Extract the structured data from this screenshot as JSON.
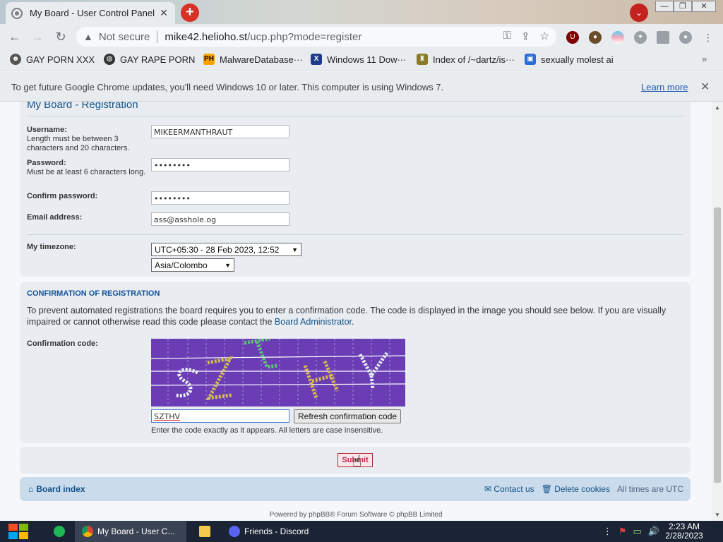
{
  "browser": {
    "tab_title": "My Board - User Control Panel",
    "not_secure": "Not secure",
    "url_host": "mike42.helioho.st",
    "url_path": "/ucp.php?mode=register",
    "infobar_message": "To get future Google Chrome updates, you'll need Windows 10 or later. This computer is using Windows 7.",
    "infobar_link": "Learn more",
    "bookmarks": [
      {
        "label": "GAY PORN XXX"
      },
      {
        "label": "GAY RAPE PORN"
      },
      {
        "label": "MalwareDatabase···"
      },
      {
        "label": "Windows 11 Dow···"
      },
      {
        "label": "Index of /~dartz/is···"
      },
      {
        "label": "sexually molest ai"
      }
    ],
    "bookmark_more": "»"
  },
  "form": {
    "page_title": "My Board - Registration",
    "username_label": "Username:",
    "username_explain": "Length must be between 3 characters and 20 characters.",
    "username_value": "MIKEERMANTHRAUT",
    "password_label": "Password:",
    "password_explain": "Must be at least 6 characters long.",
    "password_value": "••••••••",
    "confirm_label": "Confirm password:",
    "confirm_value": "••••••••",
    "email_label": "Email address:",
    "email_value": "ass@asshole.og",
    "timezone_label": "My timezone:",
    "timezone_value": "UTC+05:30 - 28 Feb 2023, 12:52",
    "timezone_city": "Asia/Colombo"
  },
  "confirmation": {
    "heading": "Confirmation of registration",
    "paragraph": "To prevent automated registrations the board requires you to enter a confirmation code. The code is displayed in the image you should see below. If you are visually impaired or cannot otherwise read this code please contact the",
    "admin_link": "Board Administrator",
    "code_label": "Confirmation code:",
    "code_value": "SZTHV",
    "refresh_label": "Refresh confirmation code",
    "note": "Enter the code exactly as it appears. All letters are case insensitive."
  },
  "submit_label": "Submit",
  "footer": {
    "board_index": "Board index",
    "contact": "Contact us",
    "delete_cookies": "Delete cookies",
    "times": "All times are UTC",
    "powered": "Powered by phpBB® Forum Software © phpBB Limited"
  },
  "taskbar": {
    "chrome_task": "My Board - User C...",
    "discord_task": "Friends - Discord",
    "time": "2:23 AM",
    "date": "2/28/2023"
  },
  "colors": {
    "link": "#105289",
    "captcha_bg": "#6a3db5",
    "submit": "#bc2a4d"
  }
}
